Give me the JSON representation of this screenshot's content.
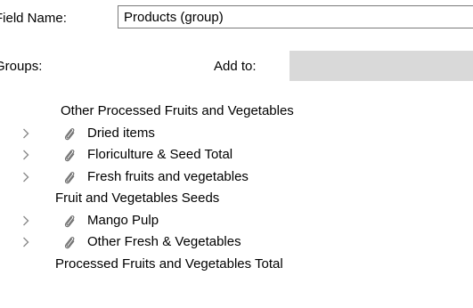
{
  "field": {
    "label": "Field Name:",
    "value": "Products (group)"
  },
  "groups": {
    "label": "Groups:",
    "add_to_label": "Add to:",
    "add_to_value": ""
  },
  "tree": {
    "header_1": "Other Processed Fruits and Vegetables",
    "items_1": [
      {
        "label": "Dried items",
        "icon": "paperclip-icon"
      },
      {
        "label": "Floriculture & Seed Total",
        "icon": "paperclip-icon"
      },
      {
        "label": "Fresh fruits and vegetables",
        "icon": "paperclip-icon"
      }
    ],
    "header_2": "Fruit and Vegetables Seeds",
    "items_2": [
      {
        "label": "Mango Pulp",
        "icon": "paperclip-icon"
      },
      {
        "label": "Other Fresh & Vegetables",
        "icon": "paperclip-icon"
      }
    ],
    "header_3": "Processed Fruits and Vegetables Total"
  }
}
